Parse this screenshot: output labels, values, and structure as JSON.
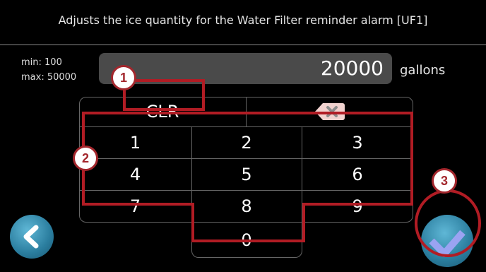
{
  "header": {
    "title": "Adjusts the ice quantity for the Water Filter reminder alarm [UF1]"
  },
  "limits": {
    "min_label": "min: 100",
    "max_label": "max: 50000"
  },
  "entry": {
    "value": "20000",
    "unit": "gallons"
  },
  "keypad": {
    "clear_label": "CLR",
    "backspace_icon": "backspace-icon",
    "keys": [
      "1",
      "2",
      "3",
      "4",
      "5",
      "6",
      "7",
      "8",
      "9",
      "0"
    ]
  },
  "nav": {
    "back_icon": "chevron-left-icon",
    "confirm_icon": "checkmark-icon"
  },
  "annotations": {
    "callout_1": "1",
    "callout_2": "2",
    "callout_3": "3"
  },
  "colors": {
    "background": "#000000",
    "field": "#4a4a4a",
    "accent": "#2a7d9e",
    "annotation": "#b11c24"
  }
}
